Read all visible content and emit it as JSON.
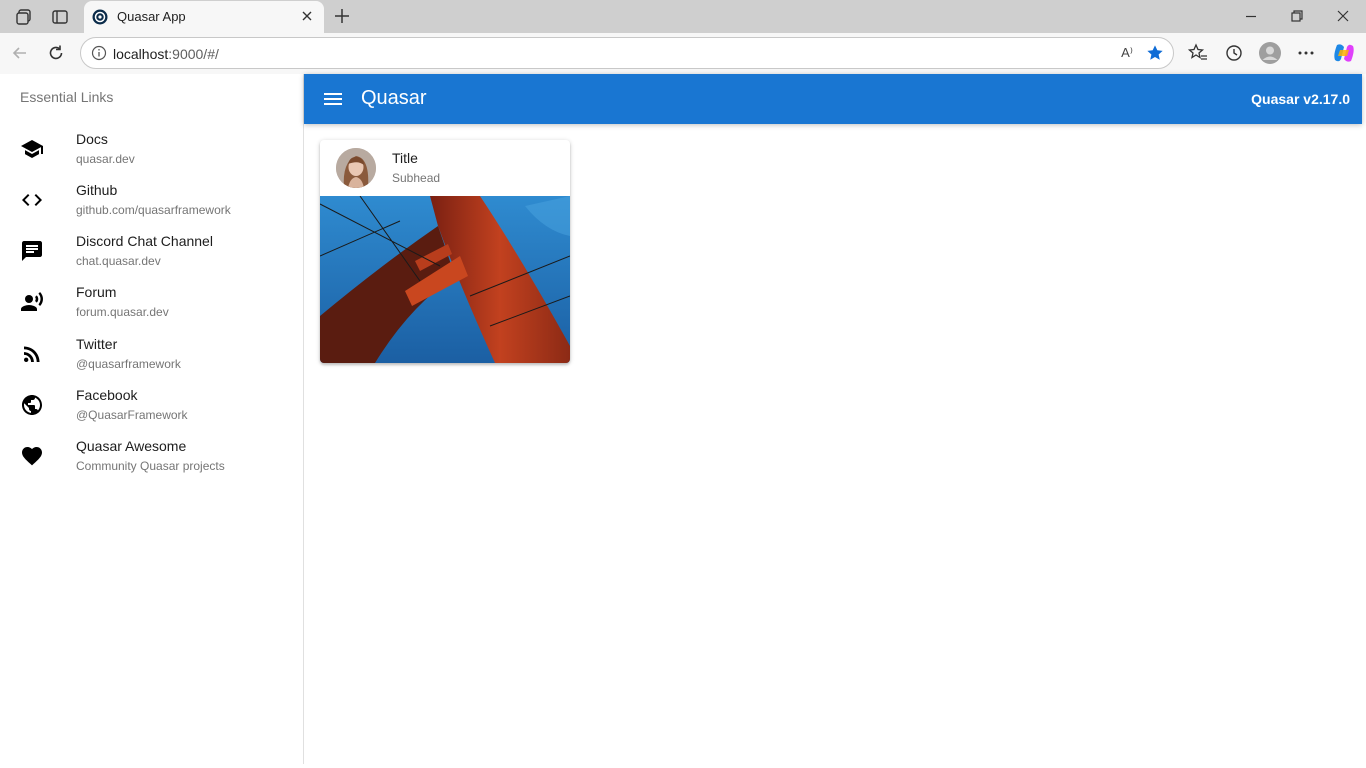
{
  "browser": {
    "tab_title": "Quasar App",
    "url_host": "localhost",
    "url_path": ":9000/#/",
    "read_aloud_label": "A⁾"
  },
  "drawer": {
    "header": "Essential Links",
    "links": [
      {
        "title": "Docs",
        "caption": "quasar.dev",
        "icon": "school-icon"
      },
      {
        "title": "Github",
        "caption": "github.com/quasarframework",
        "icon": "code-icon"
      },
      {
        "title": "Discord Chat Channel",
        "caption": "chat.quasar.dev",
        "icon": "chat-icon"
      },
      {
        "title": "Forum",
        "caption": "forum.quasar.dev",
        "icon": "record-voice-icon"
      },
      {
        "title": "Twitter",
        "caption": "@quasarframework",
        "icon": "rss-feed-icon"
      },
      {
        "title": "Facebook",
        "caption": "@QuasarFramework",
        "icon": "public-icon"
      },
      {
        "title": "Quasar Awesome",
        "caption": "Community Quasar projects",
        "icon": "favorite-icon"
      }
    ]
  },
  "header": {
    "title": "Quasar",
    "version": "Quasar v2.17.0",
    "color": "#1976d2"
  },
  "card": {
    "title": "Title",
    "subhead": "Subhead"
  }
}
